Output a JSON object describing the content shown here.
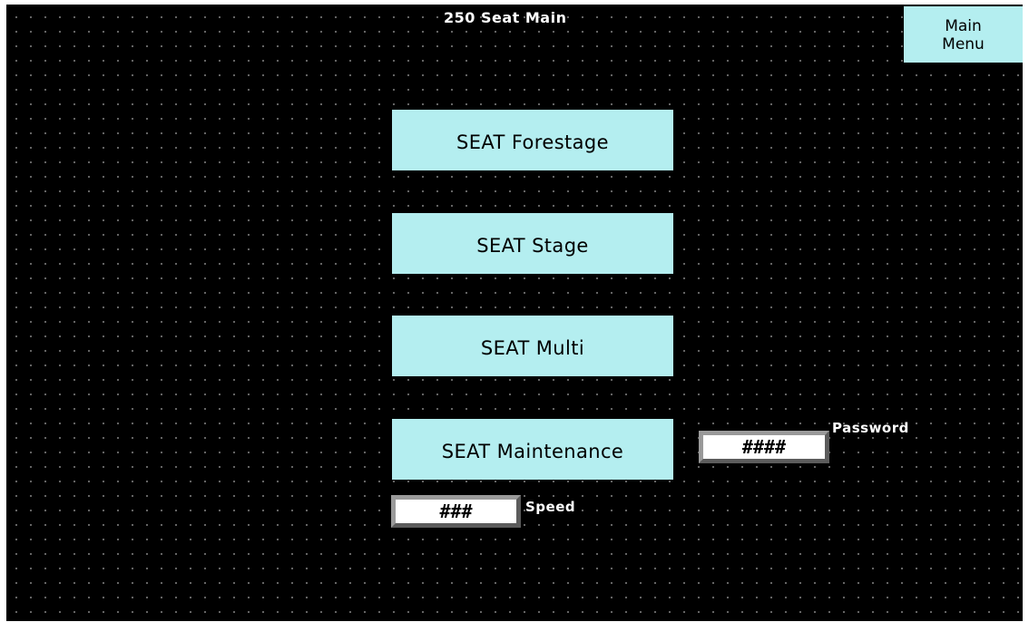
{
  "screen": {
    "title": "250 Seat Main",
    "background_color": "#000000",
    "grid_dot_color": "#6f6f6f"
  },
  "main_menu": {
    "label": "Main\nMenu"
  },
  "buttons": {
    "forestage": "SEAT Forestage",
    "stage": "SEAT Stage",
    "multi": "SEAT Multi",
    "maintenance": "SEAT Maintenance"
  },
  "password": {
    "value": "####",
    "label": "Password"
  },
  "speed": {
    "value": "###",
    "label": "Speed"
  },
  "colors": {
    "button_fill": "#b4eef0",
    "field_fill": "#ffffff",
    "field_bevel_light": "#9a9a9a",
    "field_bevel_dark": "#5c5c5c",
    "label_text": "#ffffff"
  }
}
